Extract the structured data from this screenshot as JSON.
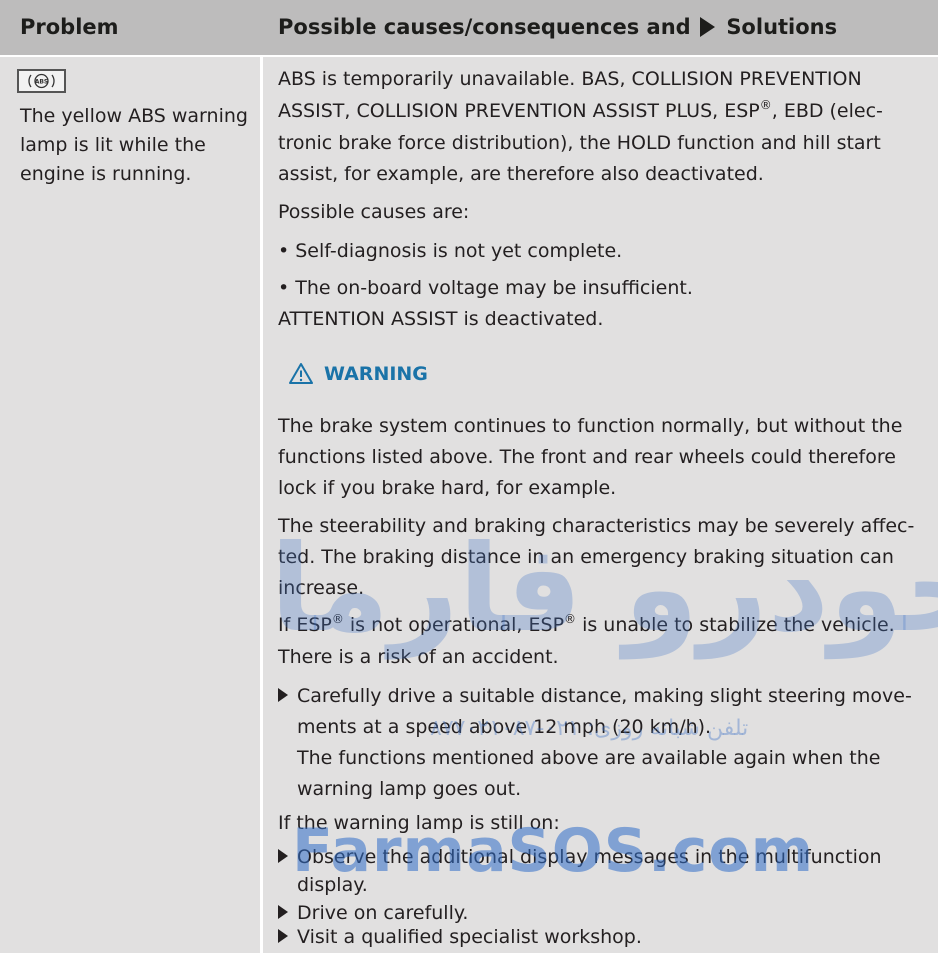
{
  "header": {
    "problem": "Problem",
    "solutions_pre": "Possible causes/consequences and",
    "solutions_post": "Solutions"
  },
  "problem": {
    "icon": "abs-warning-lamp-icon",
    "lines": [
      "The yellow ABS warning",
      "lamp is lit while the",
      "engine is running."
    ]
  },
  "solution": {
    "intro": [
      "ABS is temporarily unavailable. BAS, COLLISION PREVENTION",
      "ASSIST, COLLISION PREVENTION ASSIST PLUS, ESP",
      ", EBD (elec-",
      "tronic brake force distribution), the HOLD function and hill start",
      "assist, for example, are therefore also deactivated."
    ],
    "causes_label": "Possible causes are:",
    "causes": [
      "• Self-diagnosis is not yet complete.",
      "• The on-board voltage may be insufficient."
    ],
    "attention": "ATTENTION ASSIST is deactivated.",
    "warning_title": "WARNING",
    "warning_para1": [
      "The brake system continues to function normally, but without the",
      "functions listed above. The front and rear wheels could therefore",
      "lock if you brake hard, for example."
    ],
    "warning_para2": [
      "The steerability and braking characteristics may be severely affec-",
      "ted. The braking distance in an emergency braking situation can",
      "increase."
    ],
    "esp_line": {
      "a": "If ESP",
      "b": " is not operational, ESP",
      "c": " is unable to stabilize the vehicle."
    },
    "risk": "There is a risk of an accident.",
    "step1": [
      "Carefully drive a suitable distance, making slight steering move-",
      "ments at a speed above 12 mph (20 km/h)."
    ],
    "step1_note": [
      "The functions mentioned above are available again when the",
      "warning lamp goes out."
    ],
    "still_on": "If the warning lamp is still on:",
    "steps2": [
      [
        "Observe the additional display messages in the multifunction",
        "display."
      ],
      [
        "Drive on carefully."
      ],
      [
        "Visit a qualified specialist workshop."
      ]
    ],
    "registered": "®"
  },
  "watermarks": {
    "persian": "امداد خودرو فارما",
    "phone": "تلفن شبانه روزی: ۰۲۱-۸۷۷۰۲۱۰۸۷",
    "farma": "FarmaSOS.com"
  }
}
